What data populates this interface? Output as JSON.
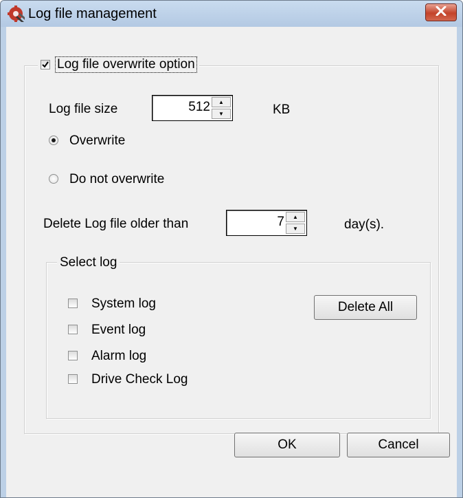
{
  "window": {
    "title": "Log file management",
    "icon": "app-tool-icon",
    "close_icon": "close-icon"
  },
  "overwrite_group": {
    "title": "Log file overwrite option",
    "checked": true,
    "log_file_size_label": "Log file size",
    "log_file_size_value": "512",
    "log_file_size_unit": "KB",
    "radio_overwrite_label": "Overwrite",
    "radio_do_not_overwrite_label": "Do not overwrite",
    "selected_mode": "Overwrite",
    "delete_older_label": "Delete Log file older than",
    "delete_older_value": "7",
    "delete_older_unit": "day(s)."
  },
  "select_log": {
    "title": "Select log",
    "items": [
      {
        "label": "System log",
        "checked": false
      },
      {
        "label": "Event log",
        "checked": false
      },
      {
        "label": "Alarm log",
        "checked": false
      },
      {
        "label": "Drive Check Log",
        "checked": false
      }
    ],
    "delete_all_label": "Delete All"
  },
  "buttons": {
    "ok_label": "OK",
    "cancel_label": "Cancel"
  },
  "colors": {
    "titlebar": "#bcd0e6",
    "close_button": "#c3432a",
    "dialog_bg": "#f0f0f0"
  }
}
